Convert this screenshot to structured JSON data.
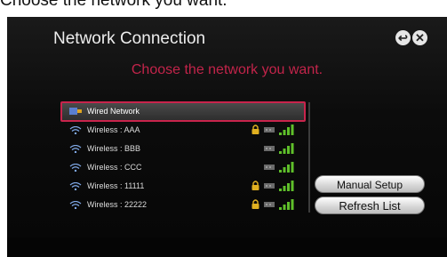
{
  "caption": "Choose the network you want.",
  "window": {
    "title": "Network Connection"
  },
  "prompt": "Choose the network you want.",
  "networks": [
    {
      "name": "Wired Network",
      "type": "wired",
      "locked": false,
      "signal": null,
      "selected": true
    },
    {
      "name": "Wireless : AAA",
      "type": "wireless",
      "locked": true,
      "signal": 4,
      "selected": false
    },
    {
      "name": "Wireless : BBB",
      "type": "wireless",
      "locked": false,
      "signal": 4,
      "selected": false
    },
    {
      "name": "Wireless : CCC",
      "type": "wireless",
      "locked": false,
      "signal": 4,
      "selected": false
    },
    {
      "name": "Wireless : 11111",
      "type": "wireless",
      "locked": true,
      "signal": 4,
      "selected": false
    },
    {
      "name": "Wireless : 22222",
      "type": "wireless",
      "locked": true,
      "signal": 4,
      "selected": false
    }
  ],
  "buttons": {
    "manual_setup": "Manual Setup",
    "refresh_list": "Refresh List"
  },
  "icons": {
    "back": "back-icon",
    "close": "close-icon",
    "wired": "wired-icon",
    "wifi": "wifi-icon",
    "lock": "lock-icon",
    "signal": "signal-strength-icon"
  },
  "colors": {
    "accent": "#c2244a",
    "signal": "#5fbf2a",
    "lock": "#e0b020",
    "background": "#0c0c0c"
  }
}
